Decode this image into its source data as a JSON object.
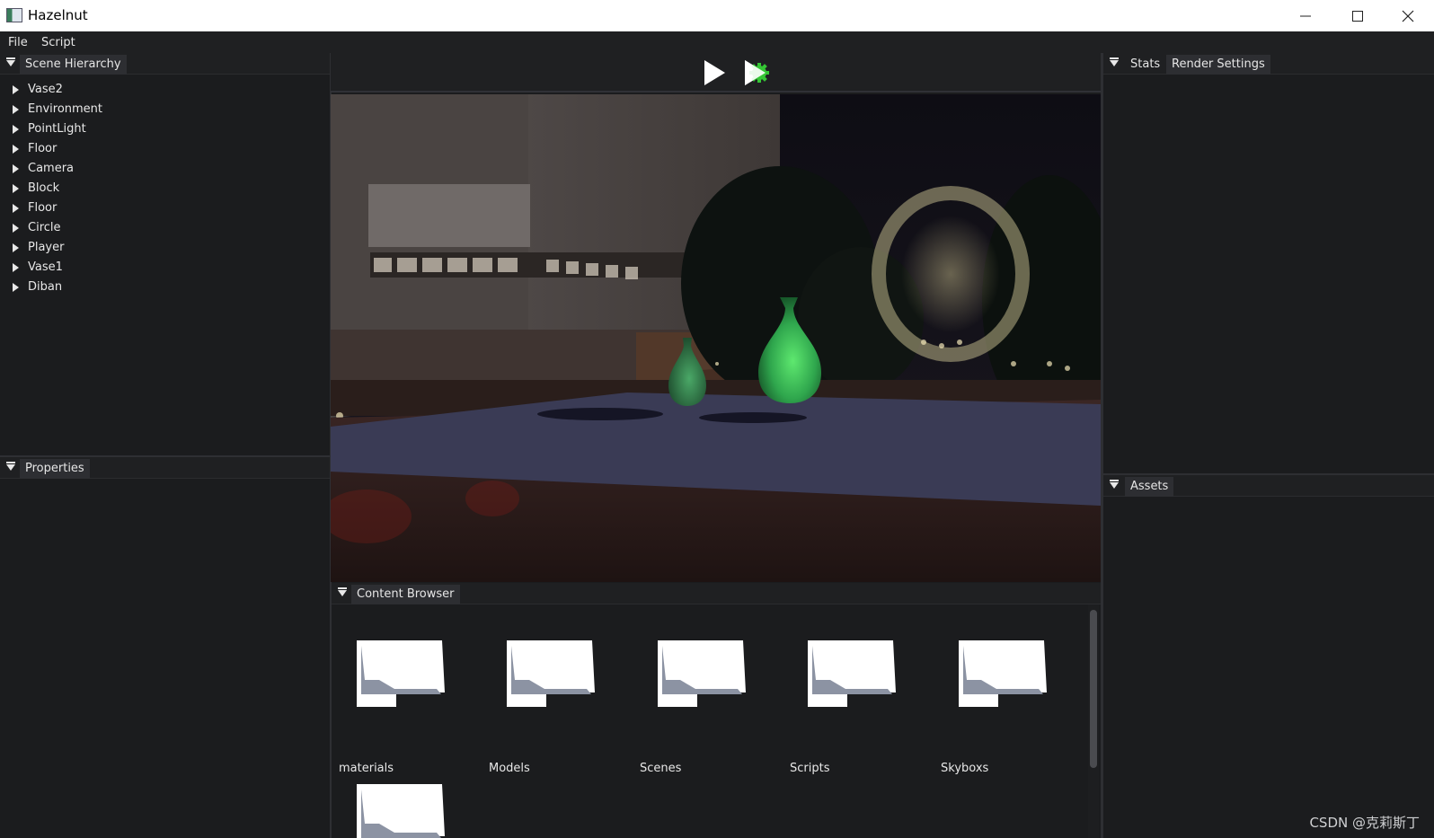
{
  "window": {
    "title": "Hazelnut",
    "minimize_label": "Minimize",
    "maximize_label": "Maximize",
    "close_label": "Close"
  },
  "menu": {
    "items": [
      "File",
      "Script"
    ]
  },
  "scene_hierarchy": {
    "tab": "Scene Hierarchy",
    "entities": [
      "Vase2",
      "Environment",
      "PointLight",
      "Floor",
      "Camera",
      "Block",
      "Floor",
      "Circle",
      "Player",
      "Vase1",
      "Diban"
    ]
  },
  "properties": {
    "tab": "Properties"
  },
  "toolbar": {
    "play_icon": "play-icon",
    "simulate_icon": "simulate-icon"
  },
  "viewport": {
    "floor_color": "#3a3b55",
    "vase_color": "#2fa64d"
  },
  "right_panel": {
    "tabs": [
      "Stats",
      "Render Settings"
    ],
    "assets_tab": "Assets"
  },
  "content_browser": {
    "tab": "Content Browser",
    "folders": [
      "materials",
      "Models",
      "Scenes",
      "Scripts",
      "Skyboxs",
      ""
    ]
  },
  "watermark": "CSDN @克莉斯丁",
  "colors": {
    "background": "#1b1c1e",
    "header": "#1f2022",
    "active_tab": "#2d2e32",
    "accent_green": "#35c635"
  }
}
